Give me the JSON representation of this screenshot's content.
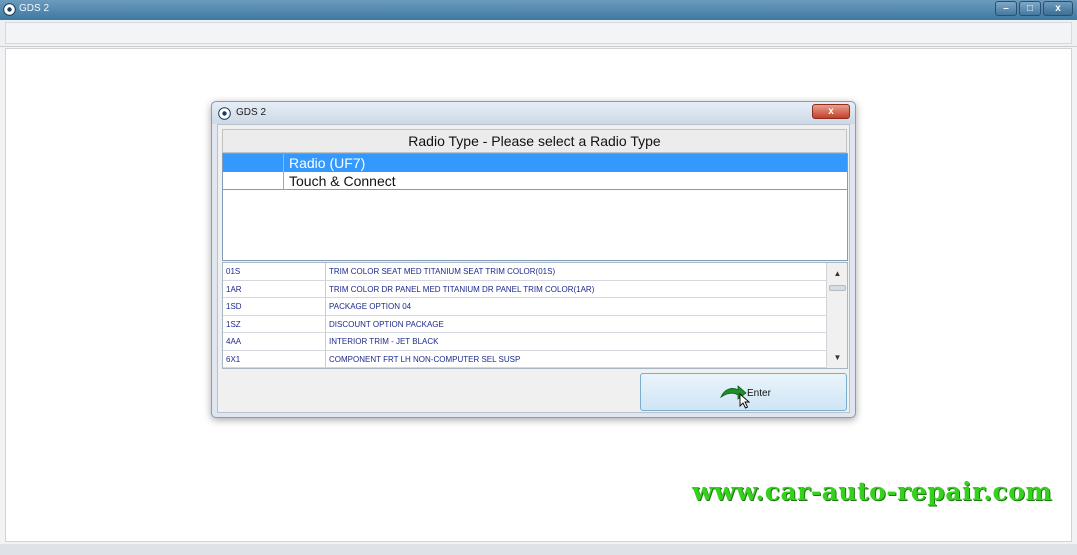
{
  "app": {
    "title": "GDS 2",
    "window_buttons": {
      "minimize": "–",
      "maximize": "□",
      "close": "x"
    }
  },
  "dialog": {
    "title": "GDS 2",
    "close_label": "x",
    "header": "Radio Type - Please select a Radio Type",
    "radio_options": [
      {
        "label": "Radio (UF7)",
        "selected": true
      },
      {
        "label": "Touch & Connect",
        "selected": false
      }
    ],
    "options_table": {
      "rows": [
        {
          "code": "01S",
          "description": "TRIM COLOR SEAT MED TITANIUM SEAT TRIM COLOR(01S)"
        },
        {
          "code": "1AR",
          "description": "TRIM COLOR DR PANEL MED TITANIUM DR PANEL TRIM COLOR(1AR)"
        },
        {
          "code": "1SD",
          "description": "PACKAGE OPTION 04"
        },
        {
          "code": "1SZ",
          "description": "DISCOUNT OPTION PACKAGE"
        },
        {
          "code": "4AA",
          "description": "INTERIOR TRIM - JET BLACK"
        },
        {
          "code": "6X1",
          "description": "COMPONENT FRT LH NON-COMPUTER SEL SUSP"
        }
      ],
      "scroll_up": "▲",
      "scroll_down": "▼"
    },
    "enter_label": "Enter"
  },
  "watermark": "www.car-auto-repair.com",
  "colors": {
    "selection": "#3399ff",
    "title_bar": "#3f78a3",
    "table_text": "#1c2a8a",
    "watermark": "#36d11e"
  },
  "icons": [
    "gds-logo-icon",
    "minimize-icon",
    "maximize-icon",
    "close-icon",
    "enter-arrow-icon",
    "mouse-cursor-icon"
  ]
}
